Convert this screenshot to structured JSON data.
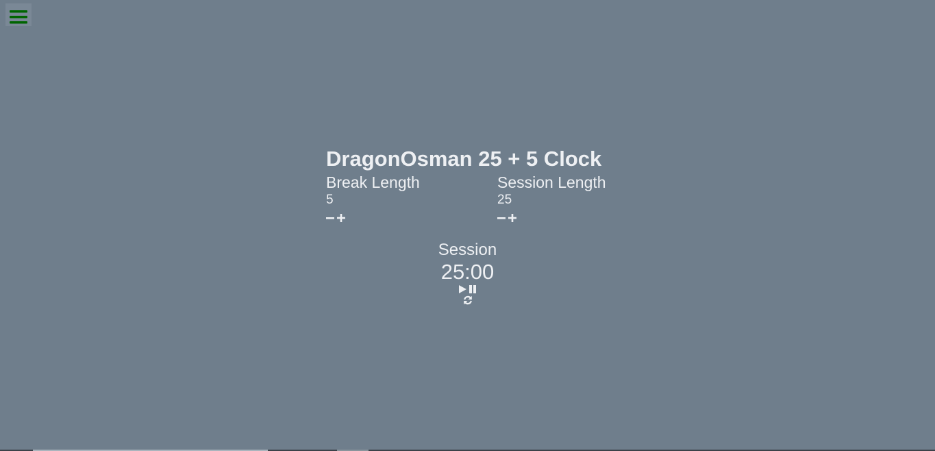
{
  "menu": {
    "icon": "hamburger-icon",
    "color": "#006400"
  },
  "clock": {
    "title": "DragonOsman 25 + 5 Clock",
    "break": {
      "label": "Break Length",
      "value": "5"
    },
    "session": {
      "label": "Session Length",
      "value": "25"
    }
  },
  "timer": {
    "label": "Session",
    "time_left": "25:00"
  },
  "colors": {
    "background": "#6f7e8c",
    "text": "#eef0f3",
    "menu_bars": "#006400"
  }
}
